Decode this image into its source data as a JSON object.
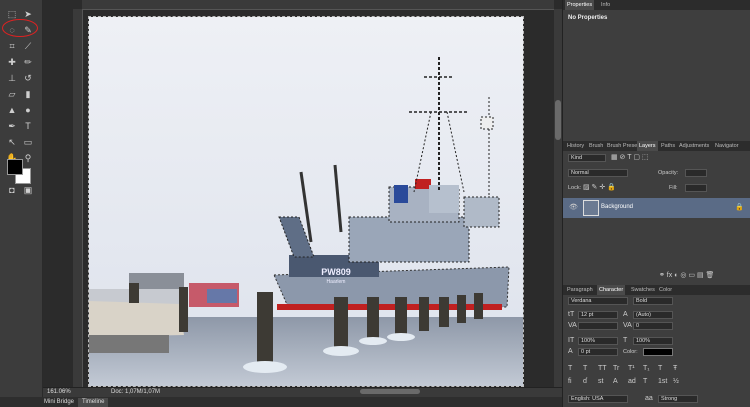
{
  "status": {
    "zoom": "161.06%",
    "doc_info": "Doc: 1,07M/1,07M"
  },
  "bottom_tabs": [
    "Mini Bridge",
    "Timeline"
  ],
  "properties_panel": {
    "tabs": [
      "Properties",
      "Info"
    ],
    "message": "No Properties"
  },
  "layers_panel": {
    "tabs": [
      "History",
      "Brush",
      "Brush Presets",
      "Layers",
      "Paths",
      "Adjustments",
      "Navigator"
    ],
    "kind_label": "Kind",
    "blend_mode": "Normal",
    "opacity_label": "Opacity:",
    "lock_label": "Lock:",
    "fill_label": "Fill:",
    "layer_name": "Background"
  },
  "character_panel": {
    "tabs": [
      "Paragraph",
      "Character",
      "Swatches",
      "Color"
    ],
    "font_family": "Verdana",
    "font_style": "Bold",
    "font_size": "12 pt",
    "leading": "(Auto)",
    "tracking": "0",
    "vert_scale": "100%",
    "horiz_scale": "100%",
    "baseline": "0 pt",
    "color_label": "Color:",
    "language": "English: USA",
    "antialias": "Strong",
    "text_style_glyphs": [
      "T",
      "T",
      "TT",
      "Tr",
      "T¹",
      "T₁",
      "T",
      "Ŧ"
    ],
    "opentype_glyphs": [
      "fi",
      "ɗ",
      "st",
      "A",
      "ad",
      "T",
      "1st",
      "½"
    ]
  },
  "photo": {
    "ship_name": "PW809",
    "ship_port": "Haarlem"
  },
  "colors": {
    "foreground": "#000000",
    "background": "#ffffff",
    "highlight": "#cc2222"
  }
}
